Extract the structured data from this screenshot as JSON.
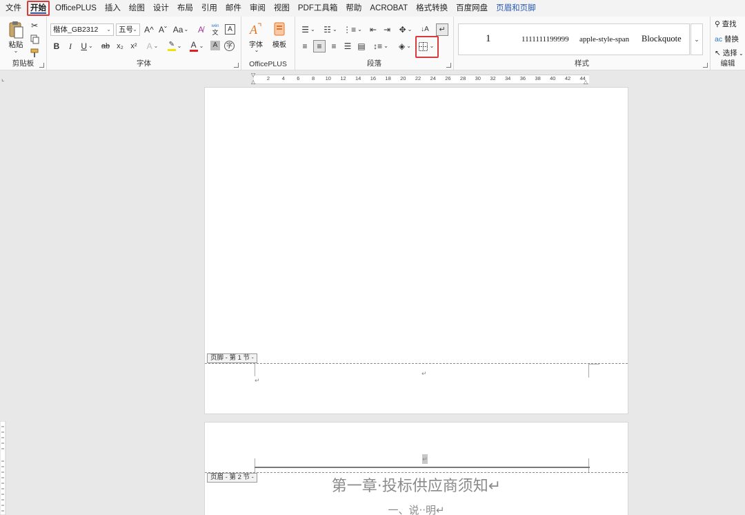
{
  "menu": [
    "文件",
    "开始",
    "OfficePLUS",
    "插入",
    "绘图",
    "设计",
    "布局",
    "引用",
    "邮件",
    "审阅",
    "视图",
    "PDF工具箱",
    "帮助",
    "ACROBAT",
    "格式转换",
    "百度网盘",
    "页眉和页脚"
  ],
  "clipboard": {
    "paste_label": "粘贴",
    "group_label": "剪贴板"
  },
  "font": {
    "name": "楷体_GB2312",
    "size": "五号",
    "grow": "A^",
    "shrink": "Aˇ",
    "case": "Aa",
    "pinyin_top": "wén",
    "pinyin_bottom": "文",
    "border_char": "A",
    "bold": "B",
    "italic": "I",
    "underline": "U",
    "strike": "ab",
    "subscript": "x₂",
    "superscript": "x²",
    "effects": "A",
    "font_color": "A",
    "shading_char": "A",
    "enclose_char": "字",
    "group_label": "字体"
  },
  "officeplus": {
    "font_label": "字体",
    "template_label": "模板",
    "group_label": "OfficePLUS"
  },
  "paragraph": {
    "group_label": "段落"
  },
  "styles": {
    "items": [
      "1",
      "1111111199999",
      "apple-style-span",
      "Blockquote"
    ],
    "group_label": "样式"
  },
  "editing": {
    "find": "查找",
    "replace": "替换",
    "select": "选择",
    "group_label": "编辑"
  },
  "ruler": {
    "ticks": [
      "2",
      "4",
      "6",
      "8",
      "10",
      "12",
      "14",
      "16",
      "18",
      "20",
      "22",
      "24",
      "26",
      "28",
      "30",
      "32",
      "34",
      "36",
      "38",
      "40",
      "42",
      "44"
    ]
  },
  "document": {
    "footer_tag": "页脚 - 第 1 节 -",
    "header_tag": "页眉 - 第 2 节 -",
    "paragraph_mark": "↵",
    "chapter_title": "第一章·投标供应商须知↵",
    "section_title": "一、说··明↵"
  },
  "colors": {
    "accent_red": "#d8393b",
    "highlight_yellow": "#f5e100",
    "font_red": "#e02020",
    "ribbon_blue": "#2b579a"
  }
}
